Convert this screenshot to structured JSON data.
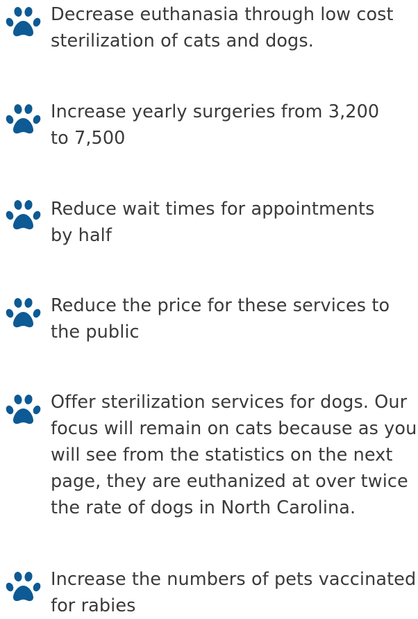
{
  "icon": {
    "name": "paw-print-icon",
    "color": "#0d5a94"
  },
  "goals": [
    {
      "lines": [
        "Decrease euthanasia through low cost",
        "sterilization of cats and dogs."
      ]
    },
    {
      "lines": [
        "Increase yearly surgeries from 3,200",
        "to 7,500"
      ]
    },
    {
      "lines": [
        "Reduce wait times for appointments",
        "by half"
      ]
    },
    {
      "lines": [
        "Reduce the price for these services to",
        "the public"
      ]
    },
    {
      "lines": [
        "Offer sterilization services for dogs. Our",
        "focus will remain on cats because as you",
        "will see from the statistics on the next",
        "page, they are euthanized at over twice",
        "the rate of dogs in North Carolina."
      ]
    },
    {
      "lines": [
        "Increase the numbers of pets vaccinated",
        "for rabies"
      ]
    }
  ]
}
